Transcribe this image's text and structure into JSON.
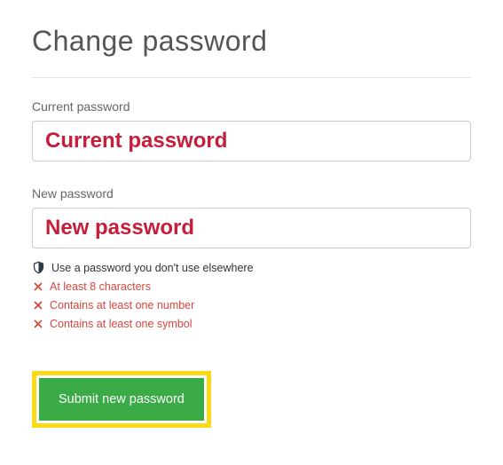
{
  "page": {
    "title": "Change password"
  },
  "fields": {
    "current": {
      "label": "Current password",
      "value": "Current password"
    },
    "new": {
      "label": "New password",
      "value": "New password"
    }
  },
  "validation": {
    "info": "Use a password you don't use elsewhere",
    "rules": [
      "At least 8 characters",
      "Contains at least one number",
      "Contains at least one symbol"
    ]
  },
  "actions": {
    "submit": "Submit new password"
  },
  "colors": {
    "accent_green": "#3aab47",
    "highlight_yellow": "#fcd916",
    "error_red": "#d9453c",
    "input_text_red": "#c41e3a"
  }
}
